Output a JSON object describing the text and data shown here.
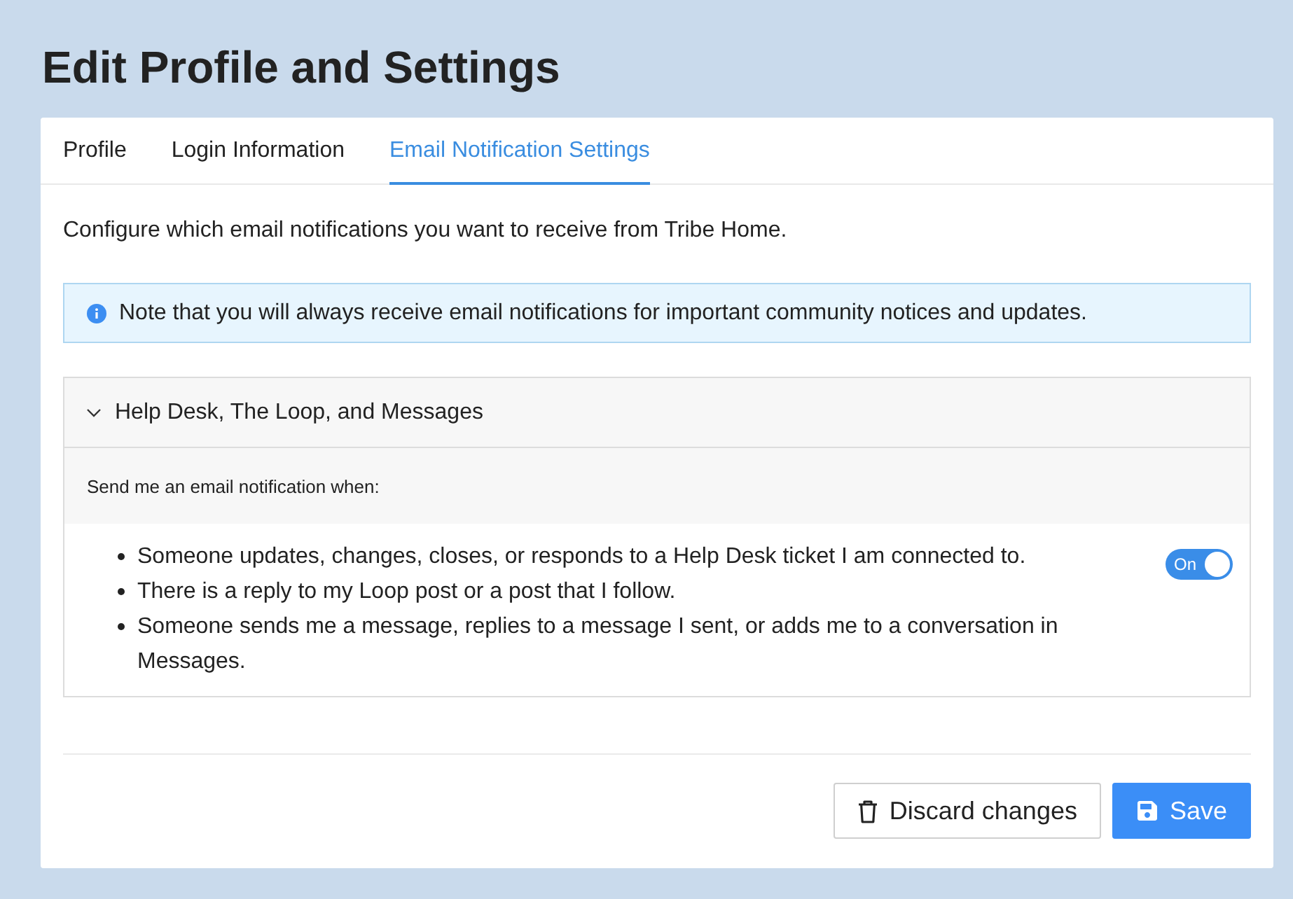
{
  "page": {
    "title": "Edit Profile and Settings"
  },
  "tabs": [
    {
      "label": "Profile",
      "selected": false
    },
    {
      "label": "Login Information",
      "selected": false
    },
    {
      "label": "Email Notification Settings",
      "selected": true
    }
  ],
  "description": "Configure which email notifications you want to receive from Tribe Home.",
  "info_note": {
    "text": "Note that you will always receive email notifications for important community notices and updates."
  },
  "sections": [
    {
      "title": "Help Desk, The Loop, and Messages",
      "expanded": true,
      "prompt": "Send me an email notification when:",
      "items": [
        "Someone updates, changes, closes, or responds to a Help Desk ticket I am connected to.",
        "There is a reply to my Loop post or a post that I follow.",
        "Someone sends me a message, replies to a message I sent, or adds me to a conversation in Messages."
      ],
      "toggle": {
        "label": "On",
        "on": true
      }
    }
  ],
  "buttons": [
    {
      "kind": "secondary",
      "label": "Discard changes"
    },
    {
      "kind": "primary",
      "label": "Save"
    }
  ]
}
